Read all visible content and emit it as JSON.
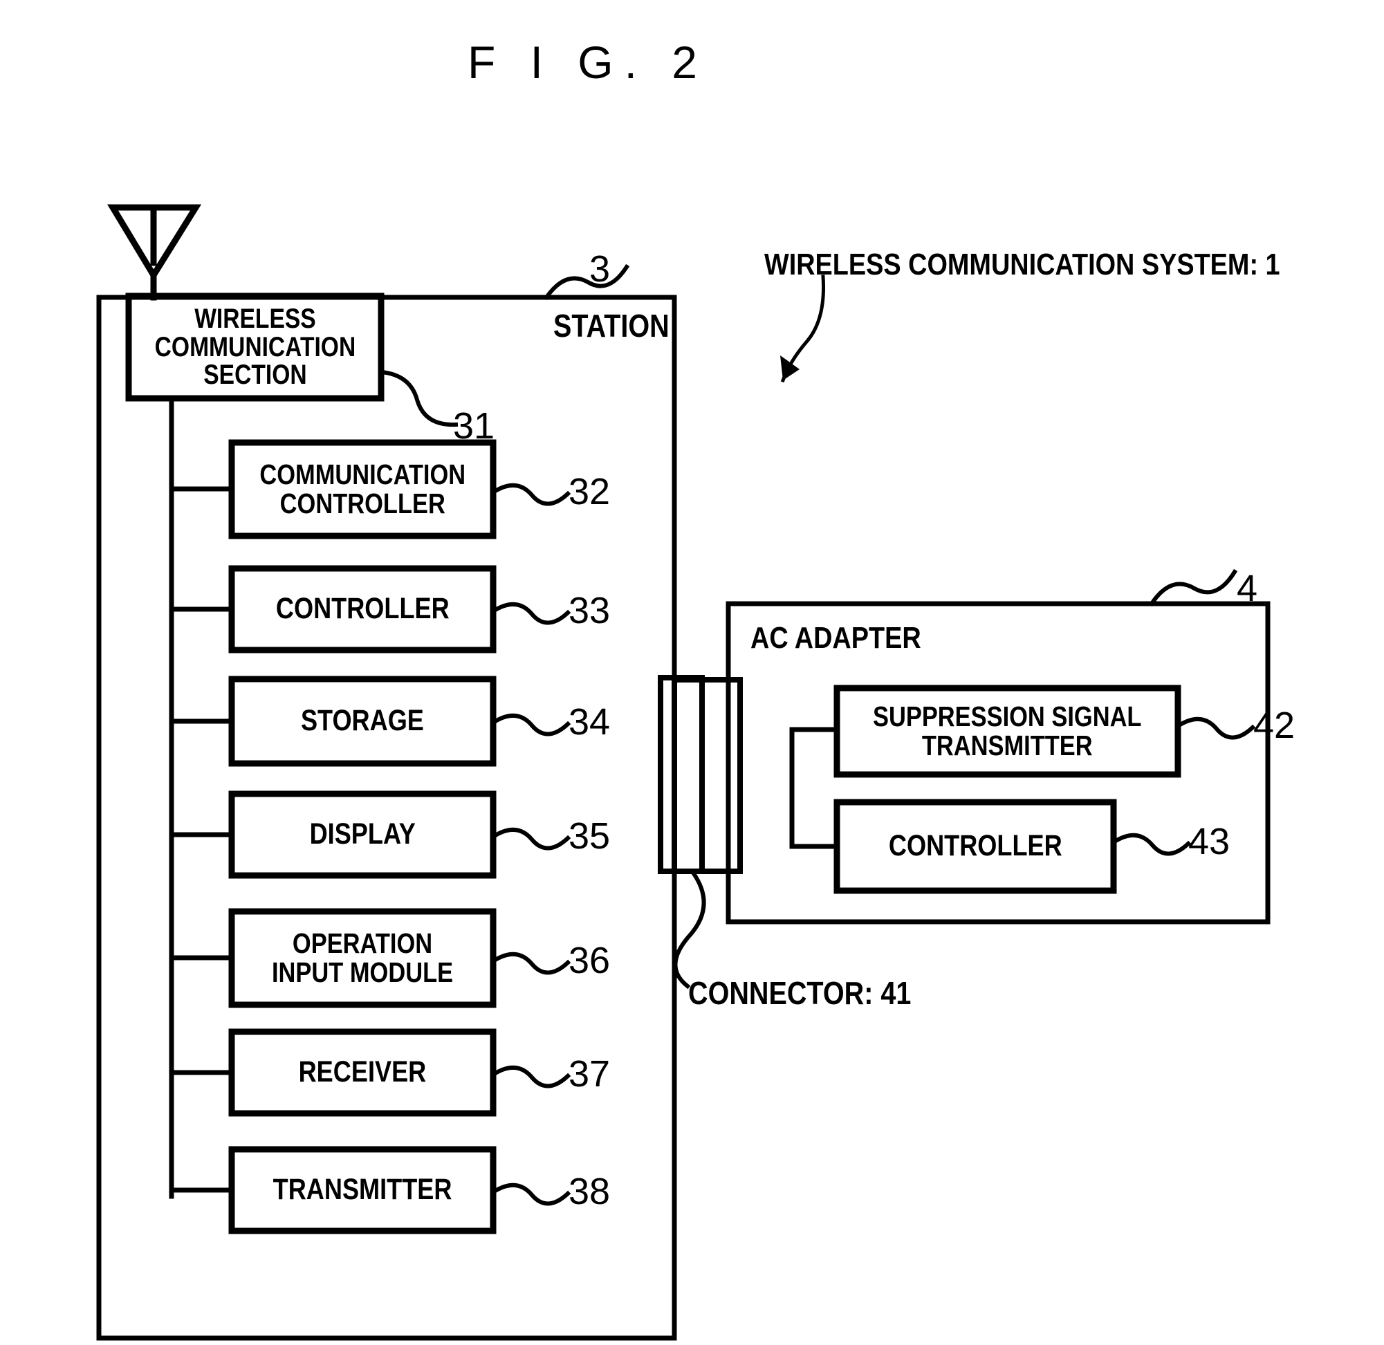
{
  "figure": {
    "title": "F I G. 2",
    "system_label": "WIRELESS COMMUNICATION SYSTEM: 1",
    "system_ref": "1"
  },
  "station": {
    "label": "STATION",
    "ref": "3",
    "antenna_name": "antenna-icon",
    "blocks": [
      {
        "label_lines": [
          "WIRELESS",
          "COMMUNICATION",
          "SECTION"
        ],
        "ref": "31",
        "name": "wireless-communication-section"
      },
      {
        "label_lines": [
          "COMMUNICATION",
          "CONTROLLER"
        ],
        "ref": "32",
        "name": "communication-controller"
      },
      {
        "label_lines": [
          "CONTROLLER"
        ],
        "ref": "33",
        "name": "controller"
      },
      {
        "label_lines": [
          "STORAGE"
        ],
        "ref": "34",
        "name": "storage"
      },
      {
        "label_lines": [
          "DISPLAY"
        ],
        "ref": "35",
        "name": "display"
      },
      {
        "label_lines": [
          "OPERATION",
          "INPUT MODULE"
        ],
        "ref": "36",
        "name": "operation-input-module"
      },
      {
        "label_lines": [
          "RECEIVER"
        ],
        "ref": "37",
        "name": "receiver"
      },
      {
        "label_lines": [
          "TRANSMITTER"
        ],
        "ref": "38",
        "name": "transmitter"
      }
    ]
  },
  "ac_adapter": {
    "label": "AC ADAPTER",
    "ref": "4",
    "blocks": [
      {
        "label_lines": [
          "SUPPRESSION SIGNAL",
          "TRANSMITTER"
        ],
        "ref": "42",
        "name": "suppression-signal-transmitter"
      },
      {
        "label_lines": [
          "CONTROLLER"
        ],
        "ref": "43",
        "name": "ac-adapter-controller"
      }
    ]
  },
  "connector": {
    "label": "CONNECTOR: 41",
    "ref": "41",
    "name": "connector"
  },
  "colors": {
    "ink": "#000000",
    "paper": "#ffffff"
  }
}
